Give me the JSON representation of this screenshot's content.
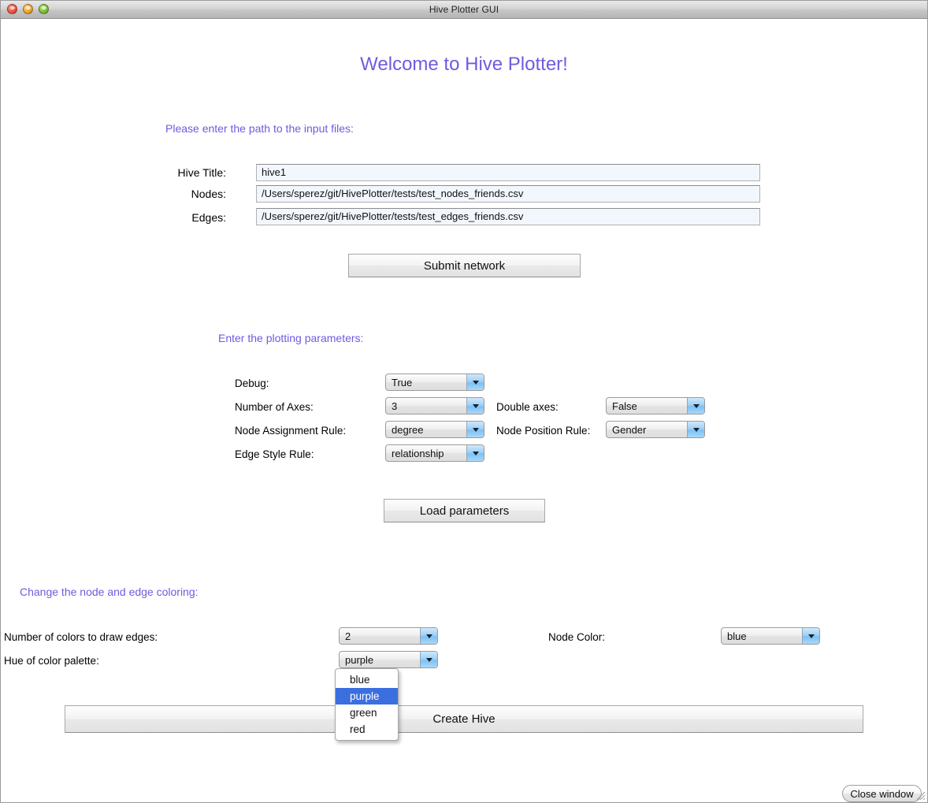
{
  "window": {
    "title": "Hive Plotter GUI",
    "traffic_lights": [
      "close-red",
      "minimize-yellow",
      "zoom-green"
    ]
  },
  "heading": "Welcome to Hive Plotter!",
  "accent_color": "#6c5ce0",
  "input_section": {
    "heading": "Please enter the path to the input files:",
    "fields": [
      {
        "label": "Hive Title:",
        "value": "hive1"
      },
      {
        "label": "Nodes:",
        "value": "/Users/sperez/git/HivePlotter/tests/test_nodes_friends.csv"
      },
      {
        "label": "Edges:",
        "value": "/Users/sperez/git/HivePlotter/tests/test_edges_friends.csv"
      }
    ],
    "submit_label": "Submit network"
  },
  "params_section": {
    "heading": "Enter the plotting parameters:",
    "left": [
      {
        "label": "Debug:",
        "value": "True"
      },
      {
        "label": "Number of Axes:",
        "value": "3"
      },
      {
        "label": "Node Assignment Rule:",
        "value": "degree"
      },
      {
        "label": "Edge Style Rule:",
        "value": "relationship"
      }
    ],
    "right": [
      {
        "label": "Double axes:",
        "value": "False"
      },
      {
        "label": "Node Position Rule:",
        "value": "Gender"
      }
    ],
    "load_label": "Load parameters"
  },
  "color_section": {
    "heading": "Change the node and edge coloring:",
    "num_colors_label": "Number of colors to draw edges:",
    "num_colors_value": "2",
    "hue_label": "Hue of color palette:",
    "hue_value": "purple",
    "node_color_label": "Node Color:",
    "node_color_value": "blue",
    "hue_menu": {
      "open": true,
      "options": [
        "blue",
        "purple",
        "green",
        "red"
      ],
      "selected": "purple",
      "highlight_color": "#3b6fe0"
    },
    "create_label": "Create Hive"
  },
  "footer": {
    "close_label": "Close window"
  }
}
